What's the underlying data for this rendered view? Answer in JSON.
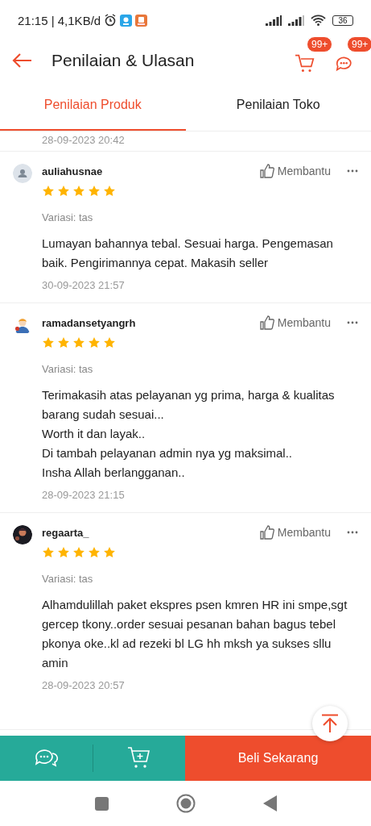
{
  "status_bar": {
    "time": "21:15 | 4,1KB/d",
    "battery": "36"
  },
  "header": {
    "title": "Penilaian & Ulasan",
    "cart_badge": "99+",
    "chat_badge": "99+"
  },
  "tabs": [
    {
      "label": "Penilaian Produk",
      "selected": true
    },
    {
      "label": "Penilaian Toko",
      "selected": false
    }
  ],
  "previous_review_date": "28-09-2023 20:42",
  "reviews": [
    {
      "user": "auliahusnae",
      "avatar": {
        "kind": "default"
      },
      "stars": 5,
      "helpful": "Membantu",
      "variation": "Variasi: tas",
      "text": "Lumayan bahannya tebal. Sesuai harga. Pengemasan baik. Pengirimannya cepat. Makasih seller",
      "date": "30-09-2023 21:57"
    },
    {
      "user": "ramadansetyangrh",
      "stars": 5,
      "helpful": "Membantu",
      "variation": "Variasi: tas",
      "text": "Terimakasih atas pelayanan yg prima, harga & kualitas barang sudah sesuai...\nWorth it dan layak..\nDi tambah pelayanan admin nya yg maksimal..\nInsha Allah berlangganan..",
      "date": "28-09-2023 21:15"
    },
    {
      "user": "regaarta_",
      "stars": 5,
      "helpful": "Membantu",
      "variation": "Variasi: tas",
      "text": "Alhamdulillah paket ekspres psen kmren HR ini smpe,sgt gercep tkony..order sesuai pesanan bahan bagus tebel pkonya oke..kl ad rezeki bl LG hh mksh ya sukses sllu amin",
      "date": "28-09-2023 20:57"
    }
  ],
  "bottom_bar": {
    "buy_button": "Beli Sekarang"
  }
}
